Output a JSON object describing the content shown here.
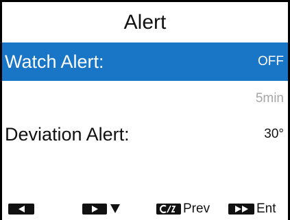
{
  "screen": {
    "title": "Alert"
  },
  "rows": {
    "watch": {
      "label": "Watch Alert:",
      "value": "OFF"
    },
    "watch_sub": {
      "value": "5min"
    },
    "deviation": {
      "label": "Deviation Alert:",
      "value": "30°"
    }
  },
  "softkeys": {
    "left": {
      "icon": "left-arrow-key-icon"
    },
    "down": {
      "icon": "right-arrow-key-icon",
      "extra_icon": "down-triangle-icon"
    },
    "prev": {
      "icon": "cancel-key-icon",
      "label": "Prev"
    },
    "enter": {
      "icon": "fast-forward-key-icon",
      "label": "Ent"
    }
  },
  "colors": {
    "selection": "#1976c6",
    "dim_value": "#a6a6a6"
  }
}
